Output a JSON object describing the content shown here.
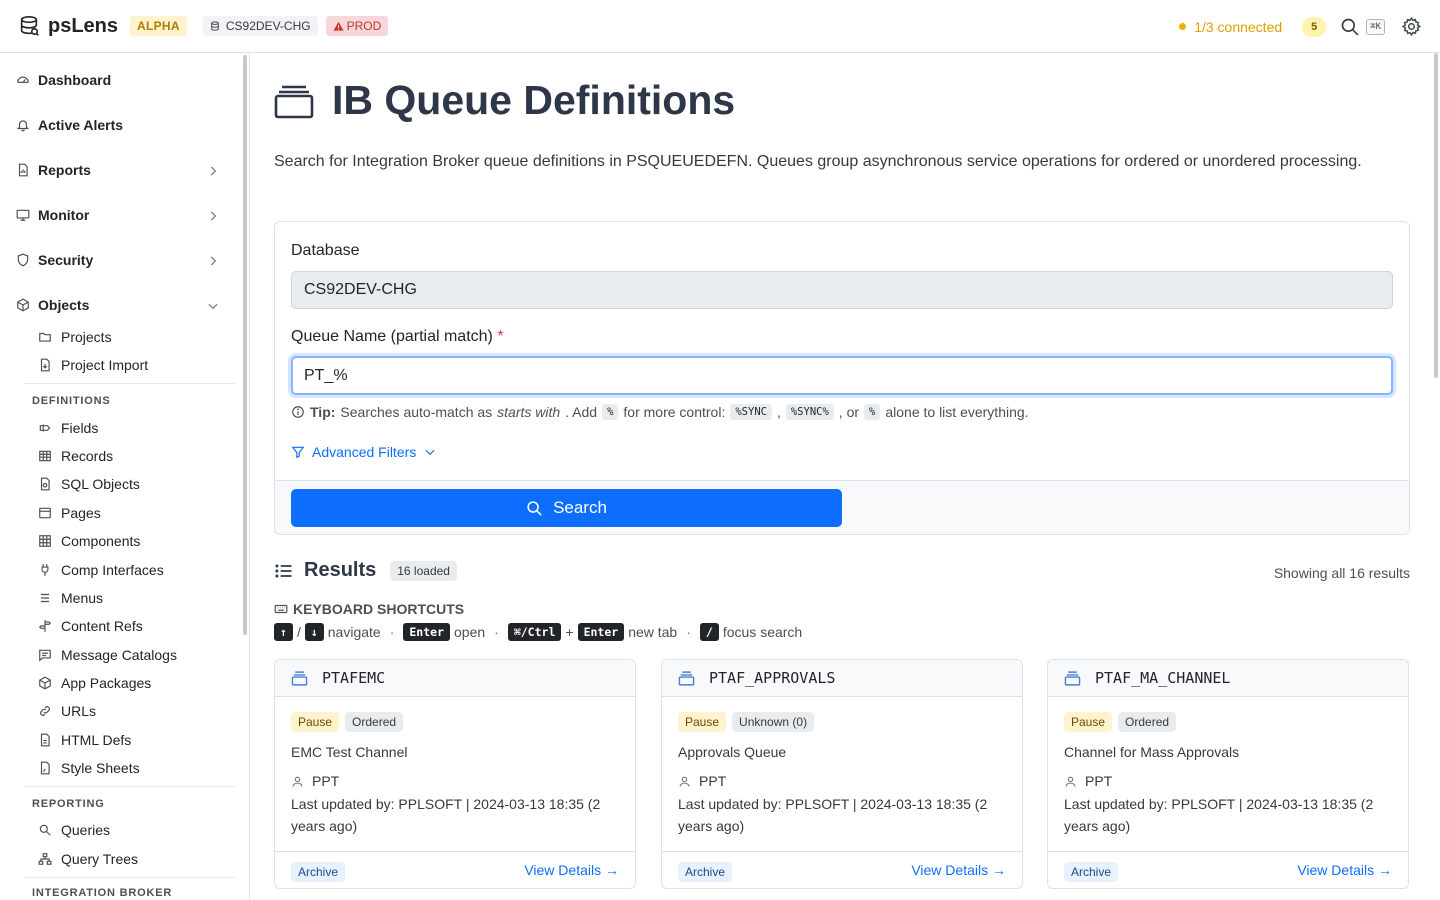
{
  "topbar": {
    "app_name": "psLens",
    "alpha_label": "ALPHA",
    "db_label": "CS92DEV-CHG",
    "prod_label": "PROD",
    "connection_text": "1/3 connected",
    "notification_count": "5",
    "shortcut_hint": "⌘K"
  },
  "sidebar": {
    "main_items": [
      {
        "label": "Dashboard"
      },
      {
        "label": "Active Alerts"
      },
      {
        "label": "Reports"
      },
      {
        "label": "Monitor"
      },
      {
        "label": "Security"
      },
      {
        "label": "Objects"
      }
    ],
    "objects_items": [
      {
        "label": "Projects"
      },
      {
        "label": "Project Import"
      }
    ],
    "definitions_heading": "DEFINITIONS",
    "definitions_items": [
      {
        "label": "Fields"
      },
      {
        "label": "Records"
      },
      {
        "label": "SQL Objects"
      },
      {
        "label": "Pages"
      },
      {
        "label": "Components"
      },
      {
        "label": "Comp Interfaces"
      },
      {
        "label": "Menus"
      },
      {
        "label": "Content Refs"
      },
      {
        "label": "Message Catalogs"
      },
      {
        "label": "App Packages"
      },
      {
        "label": "URLs"
      },
      {
        "label": "HTML Defs"
      },
      {
        "label": "Style Sheets"
      }
    ],
    "reporting_heading": "REPORTING",
    "reporting_items": [
      {
        "label": "Queries"
      },
      {
        "label": "Query Trees"
      }
    ],
    "integration_heading": "INTEGRATION BROKER"
  },
  "page": {
    "title": "IB Queue Definitions",
    "description": "Search for Integration Broker queue definitions in PSQUEUEDEFN. Queues group asynchronous service operations for ordered or unordered processing."
  },
  "form": {
    "database_label": "Database",
    "database_value": "CS92DEV-CHG",
    "queue_label": "Queue Name (partial match)",
    "required_mark": "*",
    "queue_value": "PT_%",
    "tip_strong": "Tip:",
    "tip_text_1": "Searches auto-match as",
    "tip_em": "starts with",
    "tip_text_2": ". Add",
    "tip_code_1": "%",
    "tip_text_3": "for more control:",
    "tip_code_2": "%SYNC",
    "tip_comma": ",",
    "tip_code_3": "%SYNC%",
    "tip_text_4": ", or",
    "tip_code_4": "%",
    "tip_text_5": "alone to list everything.",
    "advanced_label": "Advanced Filters",
    "search_label": "Search"
  },
  "results": {
    "title": "Results",
    "loaded_badge": "16 loaded",
    "showing_text": "Showing all 16 results",
    "shortcuts_title": "KEYBOARD SHORTCUTS",
    "shortcuts": {
      "up": "↑",
      "slash": "/",
      "down": "↓",
      "navigate": "navigate",
      "dot": "·",
      "enter": "Enter",
      "open": "open",
      "cmd_ctrl": "⌘/Ctrl",
      "plus": "+",
      "new_tab": "new tab",
      "slash_key": "/",
      "focus_search": "focus search"
    },
    "cards": [
      {
        "name": "PTAFEMC",
        "status": "Pause",
        "order": "Ordered",
        "description": "EMC Test Channel",
        "owner": "PPT",
        "updated": "Last updated by:  PPLSOFT  |  2024-03-13 18:35 (2 years ago)",
        "archive": "Archive",
        "link": "View Details →"
      },
      {
        "name": "PTAF_APPROVALS",
        "status": "Pause",
        "order": "Unknown (0)",
        "description": "Approvals Queue",
        "owner": "PPT",
        "updated": "Last updated by:  PPLSOFT  |  2024-03-13 18:35 (2 years ago)",
        "archive": "Archive",
        "link": "View Details →"
      },
      {
        "name": "PTAF_MA_CHANNEL",
        "status": "Pause",
        "order": "Ordered",
        "description": "Channel for Mass Approvals",
        "owner": "PPT",
        "updated": "Last updated by:  PPLSOFT  |  2024-03-13 18:35 (2 years ago)",
        "archive": "Archive",
        "link": "View Details →"
      }
    ]
  },
  "colors": {
    "primary": "#0d6efd",
    "warning": "#e0a100",
    "danger": "#dc3545",
    "alpha_bg": "#fff3cd"
  }
}
